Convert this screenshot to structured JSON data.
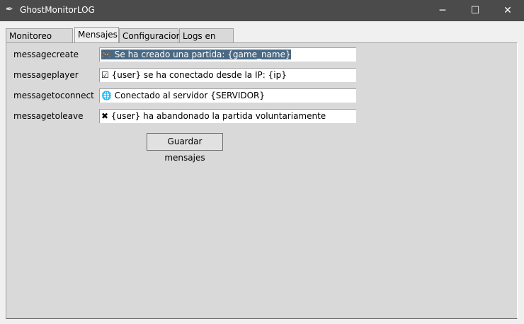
{
  "window": {
    "title": "GhostMonitorLOG",
    "minimize": "─",
    "maximize": "☐",
    "close": "✕",
    "app_icon": "✒"
  },
  "tabs": [
    {
      "label": "Monitoreo Logs"
    },
    {
      "label": "Mensajes"
    },
    {
      "label": "Configuracion"
    },
    {
      "label": "Logs en vivo"
    }
  ],
  "active_tab": "Mensajes",
  "fields": [
    {
      "label": "messagecreate",
      "value": "🎮 Se ha creado una partida: {game_name}"
    },
    {
      "label": "messageplayer",
      "value": "☑ {user} se ha conectado desde la IP: {ip}"
    },
    {
      "label": "messagetoconnect",
      "value": "🌐 Conectado al servidor {SERVIDOR}"
    },
    {
      "label": "messagetoleave",
      "value": "✖ {user} ha abandonado la partida voluntariamente"
    }
  ],
  "save_button": "Guardar mensajes"
}
